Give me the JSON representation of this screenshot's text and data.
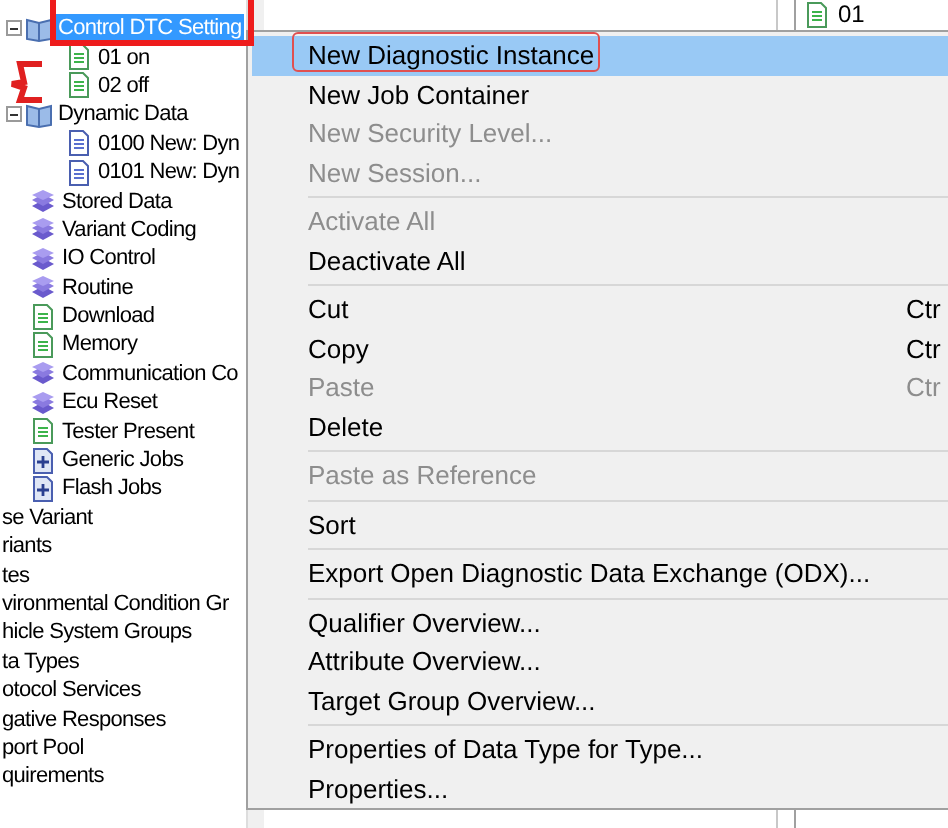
{
  "tree": {
    "items": [
      {
        "label": "Control DTC Setting",
        "kind": "group",
        "selected": true,
        "expanded": true,
        "children": [
          {
            "label": "01 on",
            "kind": "doc",
            "selected": false
          },
          {
            "label": "02 off",
            "kind": "doc",
            "selected": false
          }
        ]
      },
      {
        "label": "Dynamic Data",
        "kind": "group",
        "selected": false,
        "expanded": true,
        "children": [
          {
            "label": "0100 New: Dyn",
            "kind": "data",
            "selected": false
          },
          {
            "label": "0101 New: Dyn",
            "kind": "data",
            "selected": false
          }
        ]
      },
      {
        "label": "Stored Data",
        "kind": "service",
        "selected": false
      },
      {
        "label": "Variant Coding",
        "kind": "service",
        "selected": false
      },
      {
        "label": "IO Control",
        "kind": "service",
        "selected": false
      },
      {
        "label": "Routine",
        "kind": "service",
        "selected": false
      },
      {
        "label": "Download",
        "kind": "doc",
        "selected": false
      },
      {
        "label": "Memory",
        "kind": "doc",
        "selected": false
      },
      {
        "label": "Communication Co",
        "kind": "service",
        "selected": false
      },
      {
        "label": "Ecu Reset",
        "kind": "service",
        "selected": false
      },
      {
        "label": "Tester Present",
        "kind": "doc",
        "selected": false
      },
      {
        "label": "Generic Jobs",
        "kind": "job",
        "selected": false
      },
      {
        "label": "Flash Jobs",
        "kind": "job",
        "selected": false
      }
    ],
    "outer_items": [
      "se Variant",
      "riants",
      "tes",
      "vironmental Condition Gr",
      "hicle System Groups",
      "ta Types",
      "otocol Services",
      "gative Responses",
      "port Pool",
      "quirements"
    ]
  },
  "side_panel": {
    "items": [
      {
        "label": "01",
        "kind": "doc"
      }
    ]
  },
  "context_menu": [
    {
      "kind": "item",
      "label": "New Diagnostic Instance",
      "disabled": false,
      "selected": true
    },
    {
      "kind": "item",
      "label": "New Job Container",
      "disabled": false,
      "selected": false
    },
    {
      "kind": "item",
      "label": "New Security Level...",
      "disabled": true,
      "selected": false
    },
    {
      "kind": "item",
      "label": "New Session...",
      "disabled": true,
      "selected": false
    },
    {
      "kind": "separator"
    },
    {
      "kind": "item",
      "label": "Activate All",
      "disabled": true,
      "selected": false
    },
    {
      "kind": "item",
      "label": "Deactivate All",
      "disabled": false,
      "selected": false
    },
    {
      "kind": "separator"
    },
    {
      "kind": "item",
      "label": "Cut",
      "disabled": false,
      "selected": false,
      "shortcut": "Ctr"
    },
    {
      "kind": "item",
      "label": "Copy",
      "disabled": false,
      "selected": false,
      "shortcut": "Ctr"
    },
    {
      "kind": "item",
      "label": "Paste",
      "disabled": true,
      "selected": false,
      "shortcut": "Ctr"
    },
    {
      "kind": "item",
      "label": "Delete",
      "disabled": false,
      "selected": false
    },
    {
      "kind": "separator"
    },
    {
      "kind": "item",
      "label": "Paste as Reference",
      "disabled": true,
      "selected": false
    },
    {
      "kind": "separator"
    },
    {
      "kind": "item",
      "label": "Sort",
      "disabled": false,
      "selected": false
    },
    {
      "kind": "separator"
    },
    {
      "kind": "item",
      "label": "Export Open Diagnostic Data Exchange (ODX)...",
      "disabled": false,
      "selected": false
    },
    {
      "kind": "separator"
    },
    {
      "kind": "item",
      "label": "Qualifier Overview...",
      "disabled": false,
      "selected": false
    },
    {
      "kind": "item",
      "label": "Attribute Overview...",
      "disabled": false,
      "selected": false
    },
    {
      "kind": "item",
      "label": "Target Group Overview...",
      "disabled": false,
      "selected": false
    },
    {
      "kind": "separator"
    },
    {
      "kind": "item",
      "label": "Properties of Data Type for Type...",
      "disabled": false,
      "selected": false
    },
    {
      "kind": "item",
      "label": "Properties...",
      "disabled": false,
      "selected": false
    }
  ]
}
